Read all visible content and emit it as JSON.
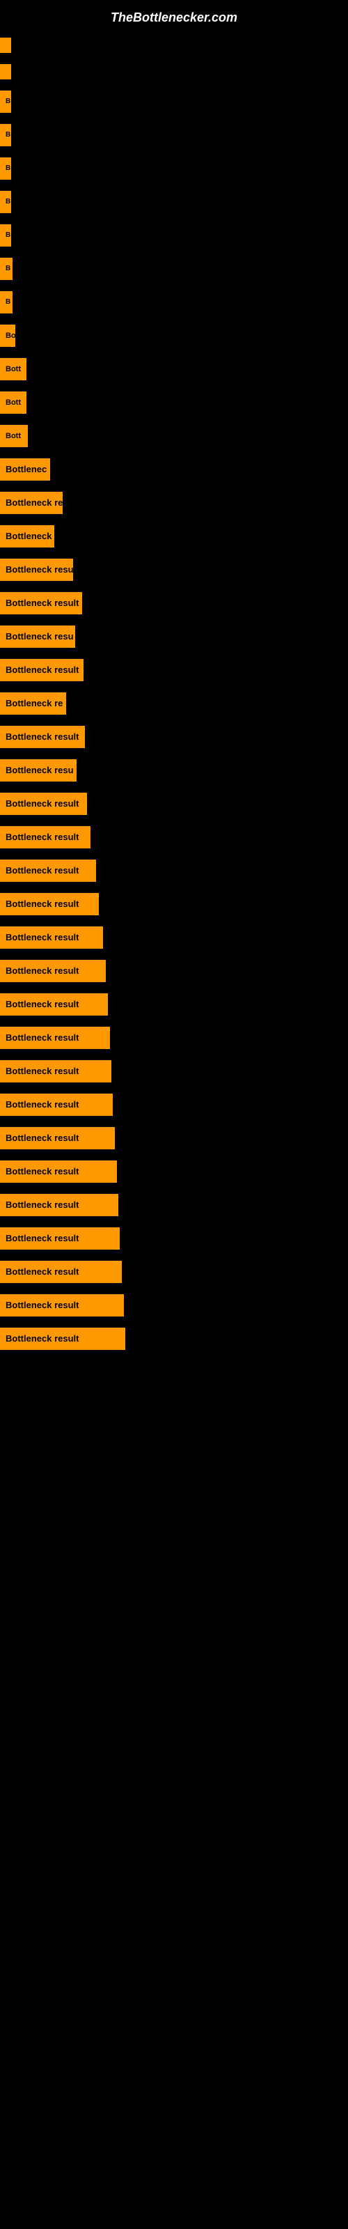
{
  "site": {
    "title": "TheBottlenecker.com"
  },
  "bars": [
    {
      "label": "",
      "width": 4
    },
    {
      "label": "",
      "width": 5
    },
    {
      "label": "B",
      "width": 14
    },
    {
      "label": "B",
      "width": 14
    },
    {
      "label": "B",
      "width": 14
    },
    {
      "label": "B",
      "width": 16
    },
    {
      "label": "B",
      "width": 16
    },
    {
      "label": "B",
      "width": 18
    },
    {
      "label": "B",
      "width": 18
    },
    {
      "label": "Bo",
      "width": 22
    },
    {
      "label": "Bott",
      "width": 38
    },
    {
      "label": "Bott",
      "width": 38
    },
    {
      "label": "Bott",
      "width": 40
    },
    {
      "label": "Bottlenec",
      "width": 72
    },
    {
      "label": "Bottleneck re",
      "width": 90
    },
    {
      "label": "Bottleneck",
      "width": 78
    },
    {
      "label": "Bottleneck resu",
      "width": 105
    },
    {
      "label": "Bottleneck result",
      "width": 118
    },
    {
      "label": "Bottleneck resu",
      "width": 108
    },
    {
      "label": "Bottleneck result",
      "width": 120
    },
    {
      "label": "Bottleneck re",
      "width": 95
    },
    {
      "label": "Bottleneck result",
      "width": 122
    },
    {
      "label": "Bottleneck resu",
      "width": 110
    },
    {
      "label": "Bottleneck result",
      "width": 125
    },
    {
      "label": "Bottleneck result",
      "width": 130
    },
    {
      "label": "Bottleneck result",
      "width": 138
    },
    {
      "label": "Bottleneck result",
      "width": 142
    },
    {
      "label": "Bottleneck result",
      "width": 148
    },
    {
      "label": "Bottleneck result",
      "width": 152
    },
    {
      "label": "Bottleneck result",
      "width": 155
    },
    {
      "label": "Bottleneck result",
      "width": 158
    },
    {
      "label": "Bottleneck result",
      "width": 160
    },
    {
      "label": "Bottleneck result",
      "width": 162
    },
    {
      "label": "Bottleneck result",
      "width": 165
    },
    {
      "label": "Bottleneck result",
      "width": 168
    },
    {
      "label": "Bottleneck result",
      "width": 170
    },
    {
      "label": "Bottleneck result",
      "width": 172
    },
    {
      "label": "Bottleneck result",
      "width": 175
    },
    {
      "label": "Bottleneck result",
      "width": 178
    },
    {
      "label": "Bottleneck result",
      "width": 180
    }
  ]
}
